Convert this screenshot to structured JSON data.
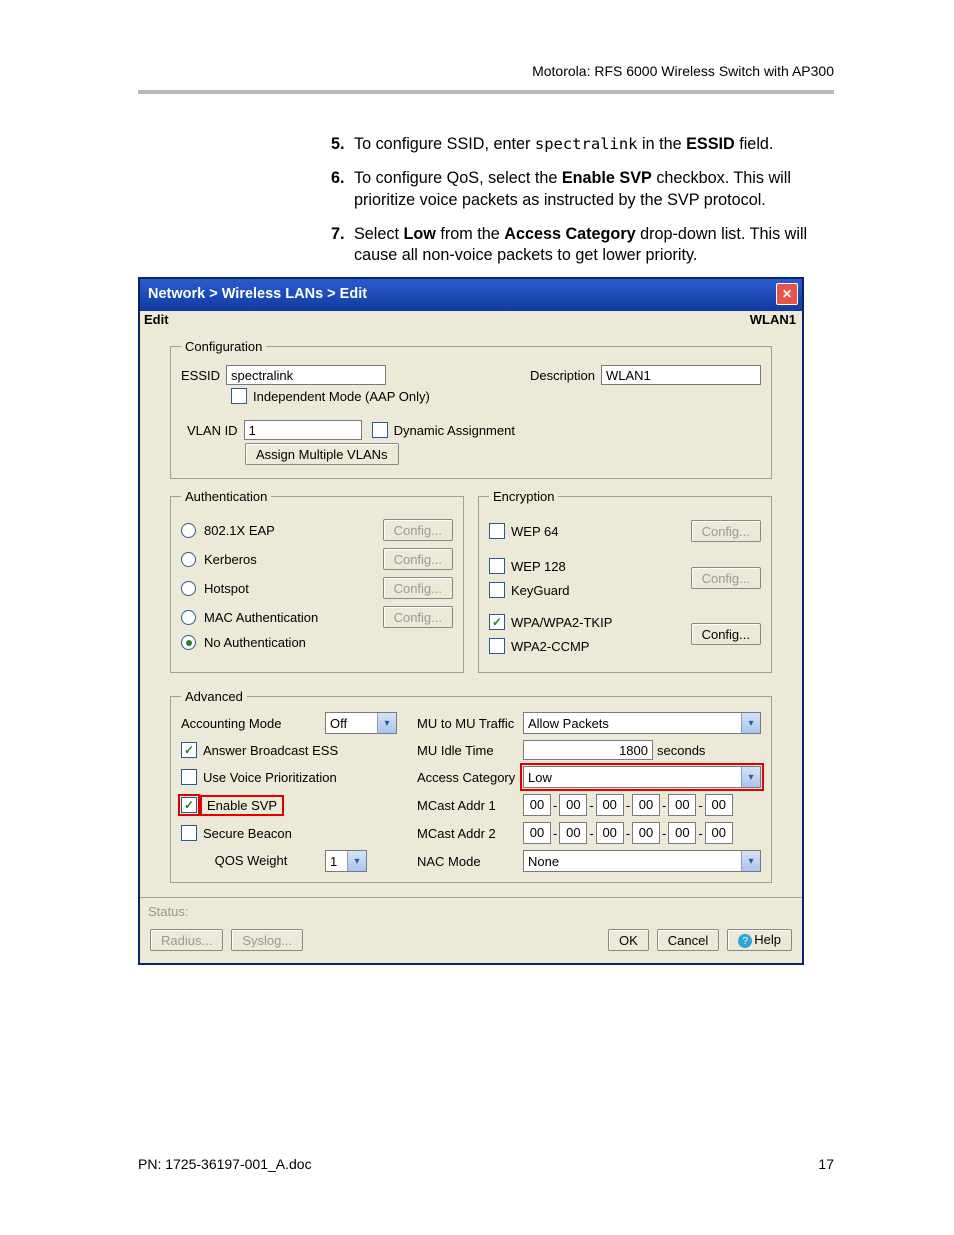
{
  "header": "Motorola: RFS 6000 Wireless Switch with AP300",
  "instructions": [
    {
      "num": "5.",
      "pre": "To configure SSID, enter ",
      "code": "spectralink",
      "mid": " in the ",
      "bold": "ESSID",
      "post": " field."
    },
    {
      "num": "6.",
      "pre": "To configure QoS, select the ",
      "bold": "Enable SVP",
      "post": " checkbox. This will prioritize voice packets as instructed by the SVP protocol."
    },
    {
      "num": "7.",
      "pre": "Select ",
      "bold": "Low",
      "mid": " from the ",
      "bold2": "Access Category",
      "post": " drop-down list. This will cause all non-voice packets to get lower priority."
    }
  ],
  "dialog": {
    "breadcrumb": "Network > Wireless LANs > Edit",
    "editLabel": "Edit",
    "wlanLabel": "WLAN1",
    "config": {
      "legend": "Configuration",
      "essidLabel": "ESSID",
      "essidValue": "spectralink",
      "descLabel": "Description",
      "descValue": "WLAN1",
      "independentLabel": "Independent Mode (AAP Only)",
      "vlanLabel": "VLAN ID",
      "vlanValue": "1",
      "dynamicLabel": "Dynamic Assignment",
      "assignBtn": "Assign Multiple VLANs"
    },
    "auth": {
      "legend": "Authentication",
      "options": [
        "802.1X EAP",
        "Kerberos",
        "Hotspot",
        "MAC Authentication",
        "No Authentication"
      ],
      "selected": 4,
      "configBtn": "Config..."
    },
    "enc": {
      "legend": "Encryption",
      "items": [
        {
          "label": "WEP 64",
          "checked": false
        },
        {
          "label": "WEP 128",
          "checked": false
        },
        {
          "label": "KeyGuard",
          "checked": false
        },
        {
          "label": "WPA/WPA2-TKIP",
          "checked": true
        },
        {
          "label": "WPA2-CCMP",
          "checked": false
        }
      ],
      "configBtn": "Config..."
    },
    "advanced": {
      "legend": "Advanced",
      "accountingLabel": "Accounting Mode",
      "accountingValue": "Off",
      "muTrafficLabel": "MU to MU Traffic",
      "muTrafficValue": "Allow Packets",
      "answerBroadcast": "Answer Broadcast ESS",
      "muIdleLabel": "MU Idle Time",
      "muIdleValue": "1800",
      "muIdleUnit": "seconds",
      "voicePrioLabel": "Use Voice Prioritization",
      "accessCatLabel": "Access Category",
      "accessCatValue": "Low",
      "enableSvpLabel": "Enable SVP",
      "mcast1Label": "MCast Addr 1",
      "secureBeaconLabel": "Secure Beacon",
      "mcast2Label": "MCast Addr 2",
      "qosWeightLabel": "QOS Weight",
      "qosWeightValue": "1",
      "nacModeLabel": "NAC Mode",
      "nacModeValue": "None",
      "macOctet": "00"
    },
    "statusLabel": "Status:",
    "footer": {
      "radius": "Radius...",
      "syslog": "Syslog...",
      "ok": "OK",
      "cancel": "Cancel",
      "help": "Help"
    }
  },
  "pageFooter": {
    "left": "PN: 1725-36197-001_A.doc",
    "right": "17"
  }
}
